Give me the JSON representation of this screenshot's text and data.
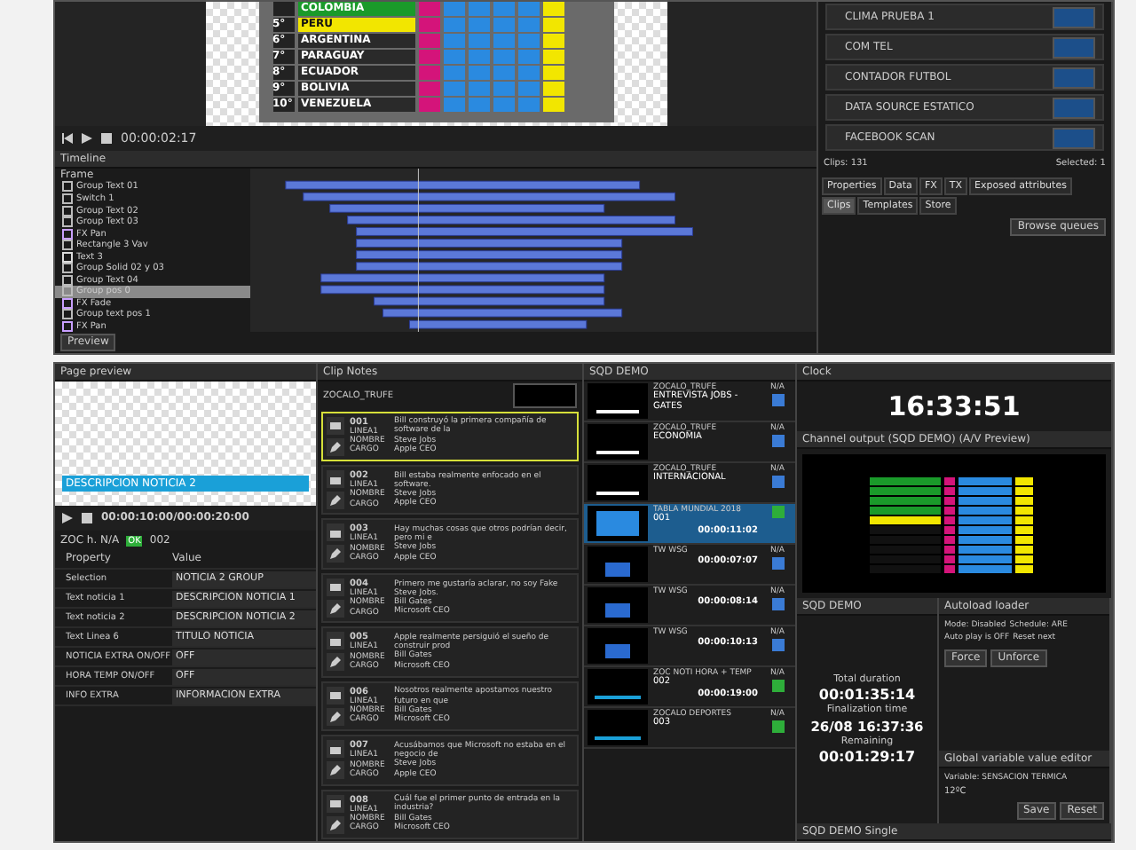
{
  "top_window": {
    "preview": {
      "standings": [
        {
          "team": "COLOMBIA",
          "color": "#1a9a2a"
        },
        {
          "pos": "5°",
          "team": "PERU",
          "color": "#f2e600"
        },
        {
          "pos": "6°",
          "team": "ARGENTINA",
          "color": "#2a2a2a"
        },
        {
          "pos": "7°",
          "team": "PARAGUAY",
          "color": "#2a2a2a"
        },
        {
          "pos": "8°",
          "team": "ECUADOR",
          "color": "#2a2a2a"
        },
        {
          "pos": "9°",
          "team": "BOLIVIA",
          "color": "#2a2a2a"
        },
        {
          "pos": "10°",
          "team": "VENEZUELA",
          "color": "#2a2a2a"
        }
      ]
    },
    "transport": {
      "time": "00:00:02:17"
    },
    "timeline": {
      "title": "Timeline",
      "frame_label": "Frame",
      "preview_button": "Preview",
      "layers": [
        {
          "name": "Group Text 01",
          "kind": "group",
          "selected": false
        },
        {
          "name": "Switch 1",
          "kind": "switch",
          "selected": false
        },
        {
          "name": "Group Text 02",
          "kind": "group",
          "selected": false
        },
        {
          "name": "Group Text 03",
          "kind": "group",
          "selected": false
        },
        {
          "name": "FX Pan",
          "kind": "fx",
          "selected": false
        },
        {
          "name": "Rectangle 3 Vav",
          "kind": "rect",
          "selected": false
        },
        {
          "name": "Text 3",
          "kind": "text",
          "selected": false
        },
        {
          "name": "Group Solid 02 y 03",
          "kind": "group",
          "selected": false
        },
        {
          "name": "Group Text 04",
          "kind": "group",
          "selected": false
        },
        {
          "name": "Group pos 0",
          "kind": "group",
          "selected": true
        },
        {
          "name": "FX Fade",
          "kind": "fx",
          "selected": false
        },
        {
          "name": "Group text pos 1",
          "kind": "group",
          "selected": false
        },
        {
          "name": "FX Pan",
          "kind": "fx",
          "selected": false
        }
      ]
    },
    "clips": {
      "items": [
        "CLIMA PRUEBA 1",
        "COM TEL",
        "CONTADOR FUTBOL",
        "DATA SOURCE ESTATICO",
        "FACEBOOK SCAN"
      ],
      "count": "Clips: 131",
      "selected_count": "Selected: 1",
      "browse_button": "Browse queues",
      "tabs": [
        {
          "label": "Properties",
          "selected": false
        },
        {
          "label": "Data",
          "selected": false
        },
        {
          "label": "FX",
          "selected": false
        },
        {
          "label": "TX",
          "selected": false
        },
        {
          "label": "Exposed attributes",
          "selected": false
        },
        {
          "label": "Clips",
          "selected": true
        },
        {
          "label": "Templates",
          "selected": false
        },
        {
          "label": "Store",
          "selected": false
        }
      ]
    }
  },
  "bottom_window": {
    "page_preview": {
      "title": "Page preview",
      "caption": "DESCRIPCION NOTICIA 2",
      "time": "00:00:10:00/00:00:20:00",
      "clip_name": "ZOC h. N/A",
      "clip_state": "OK",
      "clip_number": "002",
      "columns": [
        "Property",
        "Value"
      ],
      "properties": [
        {
          "name": "Selection",
          "value": "NOTICIA 2 GROUP"
        },
        {
          "name": "Text noticia 1",
          "value": "DESCRIPCION NOTICIA 1"
        },
        {
          "name": "Text noticia 2",
          "value": "DESCRIPCION NOTICIA 2"
        },
        {
          "name": "Text Linea 6",
          "value": "TITULO NOTICIA"
        },
        {
          "name": "NOTICIA EXTRA ON/OFF",
          "value": "OFF"
        },
        {
          "name": "HORA TEMP ON/OFF",
          "value": "OFF"
        },
        {
          "name": "INFO EXTRA",
          "value": "INFORMACION EXTRA"
        }
      ]
    },
    "clip_notes": {
      "title": "Clip Notes",
      "header": "ZOCALO_TRUFE",
      "notes": [
        {
          "number": "001",
          "labels": [
            "LINEA1",
            "NOMBRE",
            "CARGO"
          ],
          "quote": "Bill construyó la primera compañía de software de la",
          "name": "Steve Jobs",
          "role": "Apple CEO",
          "selected": true
        },
        {
          "number": "002",
          "labels": [
            "LINEA1",
            "NOMBRE",
            "CARGO"
          ],
          "quote": "Bill estaba realmente enfocado en el software.",
          "name": "Steve Jobs",
          "role": "Apple CEO",
          "selected": false
        },
        {
          "number": "003",
          "labels": [
            "LINEA1",
            "NOMBRE",
            "CARGO"
          ],
          "quote": "Hay muchas cosas que otros podrían decir, pero mi e",
          "name": "Steve Jobs",
          "role": "Apple CEO",
          "selected": false
        },
        {
          "number": "004",
          "labels": [
            "LINEA1",
            "NOMBRE",
            "CARGO"
          ],
          "quote": "Primero me gustaría aclarar, no soy Fake Steve Jobs.",
          "name": "Bill Gates",
          "role": "Microsoft CEO",
          "selected": false
        },
        {
          "number": "005",
          "labels": [
            "LINEA1",
            "NOMBRE",
            "CARGO"
          ],
          "quote": "Apple realmente persiguió el sueño de construir prod",
          "name": "Bill Gates",
          "role": "Microsoft CEO",
          "selected": false
        },
        {
          "number": "006",
          "labels": [
            "LINEA1",
            "NOMBRE",
            "CARGO"
          ],
          "quote": "Nosotros realmente apostamos nuestro futuro en que",
          "name": "Bill Gates",
          "role": "Microsoft CEO",
          "selected": false
        },
        {
          "number": "007",
          "labels": [
            "LINEA1",
            "NOMBRE",
            "CARGO"
          ],
          "quote": "Acusábamos que Microsoft no estaba en el negocio de",
          "name": "Steve Jobs",
          "role": "Apple CEO",
          "selected": false
        },
        {
          "number": "008",
          "labels": [
            "LINEA1",
            "NOMBRE",
            "CARGO"
          ],
          "quote": "Cuál fue el primer punto de entrada en la industria?",
          "name": "Bill Gates",
          "role": "Microsoft CEO",
          "selected": false
        }
      ]
    },
    "sequence": {
      "title": "SQD DEMO",
      "items": [
        {
          "kind": "bar",
          "template": "ZOCALO_TRUFE",
          "title": "ENTREVISTA JOBS - GATES",
          "status": "N/A",
          "loaded": false,
          "selected": false
        },
        {
          "kind": "bar",
          "template": "ZOCALO_TRUFE",
          "title": "ECONOMIA",
          "status": "N/A",
          "loaded": false,
          "selected": false
        },
        {
          "kind": "bar",
          "template": "ZOCALO_TRUFE",
          "title": "INTERNACIONAL",
          "status": "N/A",
          "loaded": false,
          "selected": false
        },
        {
          "kind": "table",
          "template": "TABLA MUNDIAL 2018",
          "title": "001",
          "time": "00:00:11:02",
          "loaded": true,
          "selected": true
        },
        {
          "kind": "tw",
          "template": "TW WSG",
          "time": "00:00:07:07",
          "status": "N/A",
          "loaded": false,
          "selected": false
        },
        {
          "kind": "tw",
          "template": "TW WSG",
          "time": "00:00:08:14",
          "status": "N/A",
          "loaded": false,
          "selected": false
        },
        {
          "kind": "tw",
          "template": "TW WSG",
          "time": "00:00:10:13",
          "status": "N/A",
          "loaded": false,
          "selected": false
        },
        {
          "kind": "zoc",
          "template": "ZOC NOTI HORA + TEMP",
          "title": "002",
          "time": "00:00:19:00",
          "status": "N/A",
          "loaded": true,
          "selected": false
        },
        {
          "kind": "zoc",
          "template": "ZOCALO DEPORTES",
          "title": "003",
          "status": "N/A",
          "loaded": true,
          "selected": false
        }
      ]
    },
    "clock": {
      "title": "Clock",
      "time": "16:33:51"
    },
    "channel_output": {
      "title": "Channel output (SQD DEMO) (A/V Preview)"
    },
    "sequence_stats": {
      "title": "SQD DEMO",
      "total_label": "Total duration",
      "total": "00:01:35:14",
      "finish_label": "Finalization time",
      "finish": "26/08 16:37:36",
      "remaining_label": "Remaining",
      "remaining": "00:01:29:17"
    },
    "autoload": {
      "title": "Autoload loader",
      "mode": "Mode: Disabled",
      "schedule": "Schedule: ARE",
      "autoplay": "Auto play is OFF",
      "reset": "Reset next",
      "buttons": [
        "Force",
        "Unforce"
      ]
    },
    "global_variables": {
      "title": "Global variable value editor",
      "variable": "Variable: SENSACION TERMICA",
      "value": "12ºC",
      "buttons": [
        "Save",
        "Reset"
      ]
    },
    "single": {
      "title": "SQD DEMO Single"
    }
  }
}
